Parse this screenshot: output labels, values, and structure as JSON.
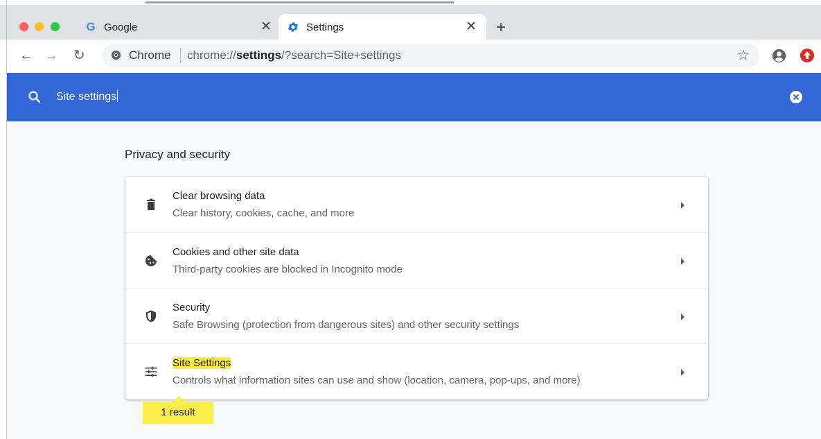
{
  "tabs": [
    {
      "title": "Google",
      "icon": "google-icon",
      "active": false
    },
    {
      "title": "Settings",
      "icon": "settings-gear-icon",
      "active": true
    }
  ],
  "toolbar": {
    "omnibox_label": "Chrome",
    "url_prefix": "chrome://",
    "url_bold": "settings",
    "url_suffix": "/?search=Site+settings"
  },
  "search": {
    "query": "Site settings"
  },
  "section": {
    "title": "Privacy and security",
    "rows": [
      {
        "title": "Clear browsing data",
        "subtitle": "Clear history, cookies, cache, and more",
        "icon": "trash-icon"
      },
      {
        "title": "Cookies and other site data",
        "subtitle": "Third-party cookies are blocked in Incognito mode",
        "icon": "cookie-icon"
      },
      {
        "title": "Security",
        "subtitle": "Safe Browsing (protection from dangerous sites) and other security settings",
        "icon": "shield-icon"
      },
      {
        "title": "Site Settings",
        "subtitle": "Controls what information sites can use and show (location, camera, pop-ups, and more)",
        "icon": "tune-sliders-icon",
        "highlighted": true
      }
    ]
  },
  "result_bubble": "1 result",
  "colors": {
    "search_bar": "#3367d6",
    "highlight": "#ffeb3b",
    "extension": "#d93025"
  }
}
